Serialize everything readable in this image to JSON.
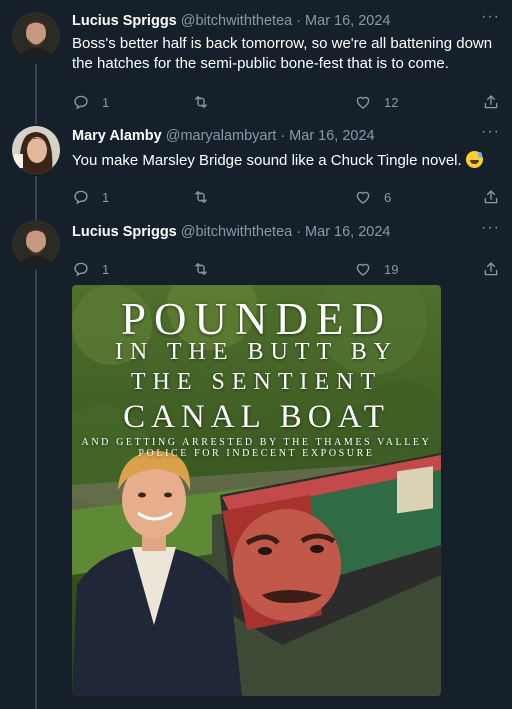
{
  "colors": {
    "background": "#15202b",
    "muted_text": "#8b98a5",
    "thread_line": "#38444d",
    "text": "#ffffff"
  },
  "tweets": [
    {
      "name": "Lucius Spriggs",
      "handle": "@bitchwiththetea",
      "separator": "·",
      "date": "Mar 16, 2024",
      "text": "Boss's better half is back tomorrow, so we're all battening down the hatches for the semi-public bone-fest that is to come.",
      "replies": "1",
      "retweets": "",
      "likes": "12",
      "more": "···"
    },
    {
      "name": "Mary Alamby",
      "handle": "@maryalambyart",
      "separator": "·",
      "date": "Mar 16, 2024",
      "text": "You make Marsley Bridge sound like a Chuck Tingle novel.",
      "emoji": "grinning-sweat-emoji",
      "replies": "1",
      "retweets": "",
      "likes": "6",
      "more": "···"
    },
    {
      "name": "Lucius Spriggs",
      "handle": "@bitchwiththetea",
      "separator": "·",
      "date": "Mar 16, 2024",
      "text": "",
      "replies": "1",
      "retweets": "",
      "likes": "19",
      "more": "···"
    }
  ],
  "media": {
    "line1": "POUNDED",
    "line2": "IN THE BUTT BY",
    "line3": "THE SENTIENT",
    "line4": "CANAL BOAT",
    "line5": "AND GETTING ARRESTED BY THE THAMES VALLEY POLICE FOR INDECENT EXPOSURE"
  },
  "icons": {
    "reply": "reply-icon",
    "retweet": "retweet-icon",
    "like": "heart-icon",
    "share": "share-icon",
    "more": "more-icon"
  }
}
